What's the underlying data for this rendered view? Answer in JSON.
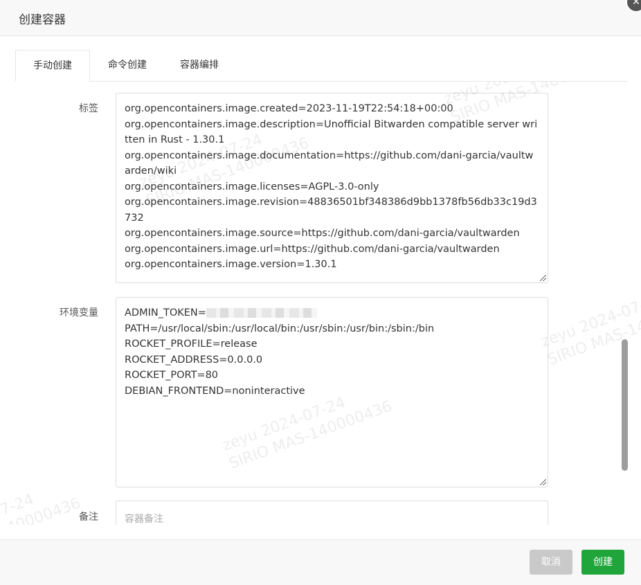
{
  "dialog": {
    "title": "创建容器",
    "close_label": "✕"
  },
  "tabs": [
    {
      "label": "手动创建",
      "active": true
    },
    {
      "label": "命令创建",
      "active": false
    },
    {
      "label": "容器编排",
      "active": false
    }
  ],
  "form": {
    "labels_field": {
      "label": "标签",
      "lines": [
        "org.opencontainers.image.created=2023-11-19T22:54:18+00:00",
        "org.opencontainers.image.description=Unofficial Bitwarden compatible server written in Rust - 1.30.1",
        "org.opencontainers.image.documentation=https://github.com/dani-garcia/vaultwarden/wiki",
        "org.opencontainers.image.licenses=AGPL-3.0-only",
        "org.opencontainers.image.revision=48836501bf348386d9bb1378fb56db33c19d3732",
        "org.opencontainers.image.source=https://github.com/dani-garcia/vaultwarden",
        "org.opencontainers.image.url=https://github.com/dani-garcia/vaultwarden",
        "org.opencontainers.image.version=1.30.1"
      ]
    },
    "env_field": {
      "label": "环境变量",
      "admin_token_key": "ADMIN_TOKEN=",
      "lines": [
        "PATH=/usr/local/sbin:/usr/local/bin:/usr/sbin:/usr/bin:/sbin:/bin",
        "ROCKET_PROFILE=release",
        "ROCKET_ADDRESS=0.0.0.0",
        "ROCKET_PORT=80",
        "DEBIAN_FRONTEND=noninteractive"
      ]
    },
    "note_field": {
      "label": "备注",
      "placeholder": "容器备注"
    }
  },
  "footer": {
    "cancel_label": "取消",
    "create_label": "创建"
  },
  "watermark": {
    "line1": "zeyu  2024-07-24",
    "line2": "SIRIO  MAS-140000436"
  },
  "colors": {
    "primary": "#20a53a",
    "cancel": "#c9c9c9"
  }
}
